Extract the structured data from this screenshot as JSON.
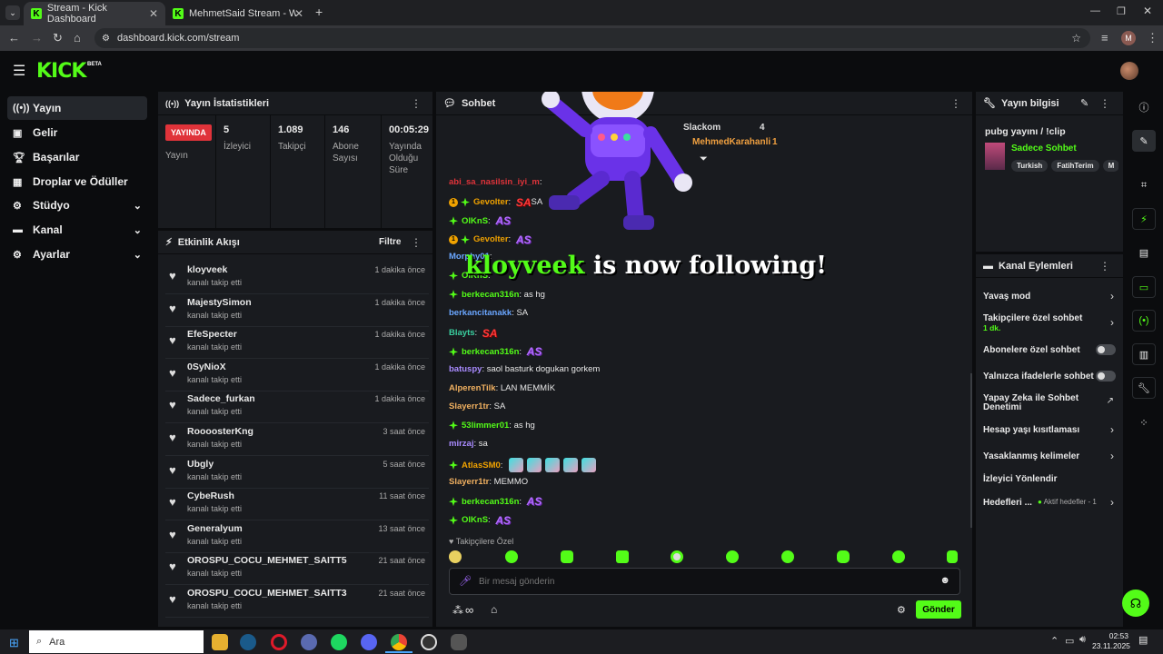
{
  "browser": {
    "tabs": [
      {
        "title": "Stream - Kick Dashboard",
        "active": true
      },
      {
        "title": "MehmetSaid Stream - Watch Li",
        "active": false
      }
    ],
    "url": "dashboard.kick.com/stream",
    "profile_initial": "M"
  },
  "header": {
    "logo": "KICK",
    "beta": "BETA"
  },
  "sidebar": {
    "items": [
      {
        "label": "Yayın",
        "icon": "broadcast-icon",
        "active": true
      },
      {
        "label": "Gelir",
        "icon": "revenue-icon"
      },
      {
        "label": "Başarılar",
        "icon": "trophy-icon"
      },
      {
        "label": "Droplar ve Ödüller",
        "icon": "gift-icon"
      },
      {
        "label": "Stüdyo",
        "icon": "studio-icon",
        "expand": true
      },
      {
        "label": "Kanal",
        "icon": "channel-icon",
        "expand": true
      },
      {
        "label": "Ayarlar",
        "icon": "gear-icon",
        "expand": true
      }
    ]
  },
  "stats": {
    "title": "Yayın İstatistikleri",
    "live_badge": "YAYINDA",
    "live_label": "Yayın",
    "items": [
      {
        "value": "5",
        "label": "İzleyici"
      },
      {
        "value": "1.089",
        "label": "Takipçi"
      },
      {
        "value": "146",
        "label": "Abone Sayısı"
      },
      {
        "value": "00:05:29",
        "label": "Yayında Olduğu Süre"
      }
    ]
  },
  "activity": {
    "title": "Etkinlik Akışı",
    "filter": "Filtre",
    "items": [
      {
        "name": "kloyveek",
        "sub": "kanalı takip etti",
        "time": "1 dakika önce"
      },
      {
        "name": "MajestySimon",
        "sub": "kanalı takip etti",
        "time": "1 dakika önce"
      },
      {
        "name": "EfeSpecter",
        "sub": "kanalı takip etti",
        "time": "1 dakika önce"
      },
      {
        "name": "0SyNioX",
        "sub": "kanalı takip etti",
        "time": "1 dakika önce"
      },
      {
        "name": "Sadece_furkan",
        "sub": "kanalı takip etti",
        "time": "1 dakika önce"
      },
      {
        "name": "RoooosterKng",
        "sub": "kanalı takip etti",
        "time": "3 saat önce"
      },
      {
        "name": "Ubgly",
        "sub": "kanalı takip etti",
        "time": "5 saat önce"
      },
      {
        "name": "CybeRush",
        "sub": "kanalı takip etti",
        "time": "11 saat önce"
      },
      {
        "name": "Generalyum",
        "sub": "kanalı takip etti",
        "time": "13 saat önce"
      },
      {
        "name": "OROSPU_COCU_MEHMET_SAITT5",
        "sub": "kanalı takip etti",
        "time": "21 saat önce"
      },
      {
        "name": "OROSPU_COCU_MEHMET_SAITT3",
        "sub": "kanalı takip etti",
        "time": "21 saat önce"
      }
    ]
  },
  "chat": {
    "title": "Sohbet",
    "top_users": [
      {
        "name": "Slackom",
        "count": "4"
      },
      {
        "name": "MehmedKarahanli",
        "count": "1"
      }
    ],
    "follow_alert": {
      "user": "kloyveek",
      "text": "is now following!"
    },
    "messages": [
      {
        "user": "abi_sa_nasilsin_iyi_m",
        "text": "",
        "color": "#e0333a"
      },
      {
        "user": "Gevolter",
        "text": "SA",
        "color": "#f0a200",
        "emote": "SA"
      },
      {
        "user": "OlKnS",
        "text": "",
        "color": "#53fc18",
        "emote": "AS"
      },
      {
        "user": "Gevolter",
        "text": "",
        "color": "#f0a200",
        "emote": "AS"
      },
      {
        "user": "Morphy01",
        "text": "",
        "color": "#6aa6ff"
      },
      {
        "user": "OlKnS",
        "text": "",
        "color": "#53fc18"
      },
      {
        "user": "berkecan316n",
        "text": "as hg",
        "color": "#53fc18"
      },
      {
        "user": "berkancitanakk",
        "text": "SA",
        "color": "#6aa6ff"
      },
      {
        "user": "Blayts",
        "text": "",
        "color": "#3ad0a0",
        "emote": "SA"
      },
      {
        "user": "berkecan316n",
        "text": "",
        "color": "#53fc18",
        "emote": "AS"
      },
      {
        "user": "batuspy",
        "text": "saol basturk dogukan gorkem",
        "color": "#a98bff"
      },
      {
        "user": "AlperenTilk",
        "text": "LAN MEMMİK",
        "color": "#f0b060"
      },
      {
        "user": "Slayerr1tr",
        "text": "SA",
        "color": "#f0b060"
      },
      {
        "user": "53limmer01",
        "text": "as hg",
        "color": "#53fc18"
      },
      {
        "user": "mirzaj",
        "text": "sa",
        "color": "#a98bff"
      },
      {
        "user": "AtlasSM0",
        "text": "",
        "color": "#f0a200"
      },
      {
        "user": "Slayerr1tr",
        "text": "MEMMO",
        "color": "#f0b060"
      },
      {
        "user": "berkecan316n",
        "text": "",
        "color": "#53fc18",
        "emote": "AS"
      },
      {
        "user": "OlKnS",
        "text": "",
        "color": "#53fc18",
        "emote": "AS"
      }
    ],
    "followers_only": "Takipçilere Özel",
    "input_placeholder": "Bir mesaj gönderin",
    "send": "Gönder"
  },
  "stream_info": {
    "title": "Yayın bilgisi",
    "stream_title": "pubg yayını / !clip",
    "category": "Sadece Sohbet",
    "tags": [
      "Turkish",
      "FatihTerim",
      "M"
    ]
  },
  "channel_actions": {
    "title": "Kanal Eylemleri",
    "items": [
      {
        "label": "Yavaş mod",
        "type": "chevron"
      },
      {
        "label": "Takipçilere özel sohbet",
        "sub": "1 dk.",
        "type": "chevron"
      },
      {
        "label": "Abonelere özel sohbet",
        "type": "toggle"
      },
      {
        "label": "Yalnızca ifadelerle sohbet",
        "type": "toggle"
      },
      {
        "label": "Yapay Zeka ile Sohbet Denetimi",
        "type": "external"
      },
      {
        "label": "Hesap yaşı kısıtlaması",
        "type": "chevron"
      },
      {
        "label": "Yasaklanmış kelimeler",
        "type": "chevron"
      },
      {
        "label": "İzleyici Yönlendir",
        "type": "none"
      },
      {
        "label": "Hedefleri ...",
        "sub": "Aktif hedefler - 1",
        "type": "chevron"
      }
    ]
  },
  "taskbar": {
    "search": "Ara",
    "time": "02:53",
    "date": "23.11.2025"
  }
}
